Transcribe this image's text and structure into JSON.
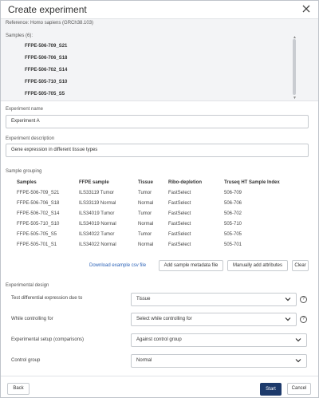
{
  "dialog": {
    "title": "Create experiment"
  },
  "reference": {
    "text": "Reference: Homo sapiens (GRCh38.103)"
  },
  "samples": {
    "label": "Samples (6):",
    "items": [
      "FFPE-506-709_S21",
      "FFPE-506-706_S18",
      "FFPE-506-702_S14",
      "FFPE-505-710_S10",
      "FFPE-505-705_S5"
    ]
  },
  "experiment_name": {
    "label": "Experiment name",
    "value": "Experiment A"
  },
  "experiment_description": {
    "label": "Experiment description",
    "value": "Gene expression in different tissue types"
  },
  "sample_grouping": {
    "label": "Sample grouping",
    "columns": [
      "Samples",
      "FFPE sample",
      "Tissue",
      "Ribo-depletion",
      "Truseq HT Sample Index"
    ],
    "rows": [
      [
        "FFPE-506-709_S21",
        "ILS33119 Tumor",
        "Tumor",
        "FastSelect",
        "506-709"
      ],
      [
        "FFPE-506-706_S18",
        "ILS33119 Normal",
        "Normal",
        "FastSelect",
        "506-706"
      ],
      [
        "FFPE-506-702_S14",
        "ILS34019 Tumor",
        "Tumor",
        "FastSelect",
        "506-702"
      ],
      [
        "FFPE-505-710_S10",
        "ILS34019 Normal",
        "Normal",
        "FastSelect",
        "505-710"
      ],
      [
        "FFPE-505-705_S5",
        "ILS34022 Tumor",
        "Tumor",
        "FastSelect",
        "505-705"
      ],
      [
        "FFPE-505-701_S1",
        "ILS34022 Normal",
        "Normal",
        "FastSelect",
        "505-701"
      ]
    ],
    "download_link": "Download example csv file",
    "add_metadata_btn": "Add sample metadata file",
    "manual_attr_btn": "Manually add attributes",
    "clear_btn": "Clear"
  },
  "experimental_design": {
    "label": "Experimental design",
    "differential_label": "Test differential expression due to",
    "differential_value": "Tissue",
    "controlling_label": "While controlling for",
    "controlling_value": "Select while controlling for",
    "setup_label": "Experimental setup (comparisons)",
    "setup_value": "Against control group",
    "control_label": "Control group",
    "control_value": "Normal",
    "help_glyph": "?"
  },
  "footer": {
    "back": "Back",
    "start": "Start",
    "cancel": "Cancel"
  },
  "colors": {
    "primary": "#1d3a6b",
    "link": "#2b62b7",
    "panel": "#f3f4f6"
  }
}
